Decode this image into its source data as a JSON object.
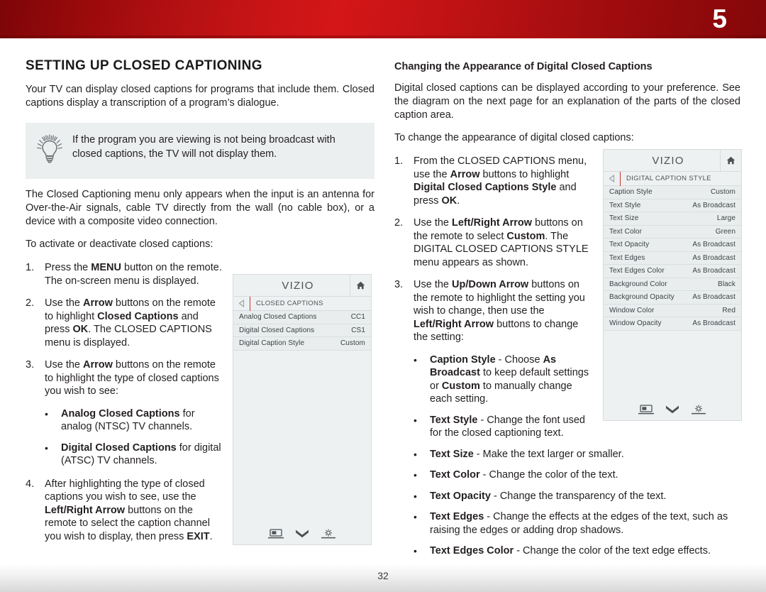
{
  "header": {
    "chapter_number": "5",
    "banner_color": "#c41416"
  },
  "left_column": {
    "title": "SETTING UP CLOSED CAPTIONING",
    "intro": "Your TV can display closed captions for programs that include them. Closed captions display a transcription of a program’s dialogue.",
    "tip": {
      "icon": "lightbulb-icon",
      "text": "If the program you are viewing is not being broadcast with closed captions, the TV will not display them."
    },
    "paragraph_2": "The Closed Captioning menu only appears when the input is an antenna for Over-the-Air signals, cable TV directly from the wall (no cable box), or a device with a composite video connection.",
    "paragraph_3": "To activate or deactivate closed captions:",
    "steps": [
      {
        "num": "1.",
        "html": "Press the <b>MENU</b> button on the remote. The on-screen menu is displayed."
      },
      {
        "num": "2.",
        "html": "Use the <b>Arrow</b> buttons on the remote to highlight <b>Closed Captions</b> and press <b>OK</b>. The CLOSED CAPTIONS menu is displayed."
      },
      {
        "num": "3.",
        "html": "Use the <b>Arrow</b> buttons on the remote to highlight the type of closed captions you wish to see:"
      }
    ],
    "step3_bullets": [
      {
        "dot": "•",
        "html": "<b>Analog Closed Captions</b> for analog (NTSC) TV channels."
      },
      {
        "dot": "•",
        "html": "<b>Digital Closed Captions</b> for digital (ATSC) TV channels."
      }
    ],
    "step4": {
      "num": "4.",
      "html": "After highlighting the type of closed captions you wish to see, use the <b>Left/Right Arrow</b> buttons on the remote to select the caption channel you wish to display, then press <b>EXIT</b>."
    }
  },
  "right_column": {
    "subhead": "Changing the Appearance of Digital Closed Captions",
    "paragraph_1": "Digital closed captions can be displayed according to your preference. See the diagram on the next page for an explanation of the parts of the closed caption area.",
    "paragraph_2": "To change the appearance of digital closed captions:",
    "steps": [
      {
        "num": "1.",
        "html": "From the CLOSED CAPTIONS menu, use the <b>Arrow</b> buttons to highlight <b>Digital Closed Captions Style</b> and press <b>OK</b>."
      },
      {
        "num": "2.",
        "html": "Use the <b>Left/Right Arrow</b> buttons on the remote to select <b>Custom</b>. The DIGITAL CLOSED CAPTIONS STYLE menu appears as shown."
      },
      {
        "num": "3.",
        "html": "Use the <b>Up/Down Arrow</b> buttons on the remote to highlight the setting you wish to change, then use the <b>Left/Right Arrow</b> buttons to change the setting:"
      }
    ],
    "bullets": [
      {
        "dot": "•",
        "html": "<b>Caption Style</b> - Choose <b>As Broadcast</b> to keep default settings or <b>Custom</b> to manually change each setting."
      },
      {
        "dot": "•",
        "html": "<b>Text Style</b>  - Change the font used for the closed captioning text."
      },
      {
        "dot": "•",
        "html": "<b>Text Size</b> - Make the text larger or smaller."
      },
      {
        "dot": "•",
        "html": "<b>Text Color</b> - Change the color of the text."
      },
      {
        "dot": "•",
        "html": "<b>Text Opacity</b> - Change the transparency of the text."
      },
      {
        "dot": "•",
        "html": "<b>Text Edges</b> - Change the effects at the edges of the text, such as raising the edges or adding drop shadows."
      },
      {
        "dot": "•",
        "html": "<b>Text Edges Color</b> - Change the color of the text edge effects."
      }
    ]
  },
  "tv_menu_closed_captions": {
    "brand": "VIZIO",
    "home_icon": "home-icon",
    "back_icon": "back-arrow-icon",
    "breadcrumb": "CLOSED CAPTIONS",
    "rows": [
      {
        "label": "Analog Closed Captions",
        "value": "CC1"
      },
      {
        "label": "Digital Closed Captions",
        "value": "CS1"
      },
      {
        "label": "Digital Caption Style",
        "value": "Custom"
      }
    ],
    "footer_icons": [
      "picture-mode-icon",
      "chevron-down-icon",
      "settings-gear-icon"
    ]
  },
  "tv_menu_caption_style": {
    "brand": "VIZIO",
    "home_icon": "home-icon",
    "back_icon": "back-arrow-icon",
    "breadcrumb": "DIGITAL CAPTION STYLE",
    "rows": [
      {
        "label": "Caption Style",
        "value": "Custom"
      },
      {
        "label": "Text Style",
        "value": "As Broadcast"
      },
      {
        "label": "Text Size",
        "value": "Large"
      },
      {
        "label": "Text Color",
        "value": "Green"
      },
      {
        "label": "Text Opacity",
        "value": "As Broadcast"
      },
      {
        "label": "Text Edges",
        "value": "As Broadcast"
      },
      {
        "label": "Text Edges Color",
        "value": "As Broadcast"
      },
      {
        "label": "Background Color",
        "value": "Black"
      },
      {
        "label": "Background Opacity",
        "value": "As Broadcast"
      },
      {
        "label": "Window Color",
        "value": "Red"
      },
      {
        "label": "Window Opacity",
        "value": "As Broadcast"
      }
    ],
    "footer_icons": [
      "picture-mode-icon",
      "chevron-down-icon",
      "settings-gear-icon"
    ]
  },
  "footer": {
    "page_number": "32"
  }
}
